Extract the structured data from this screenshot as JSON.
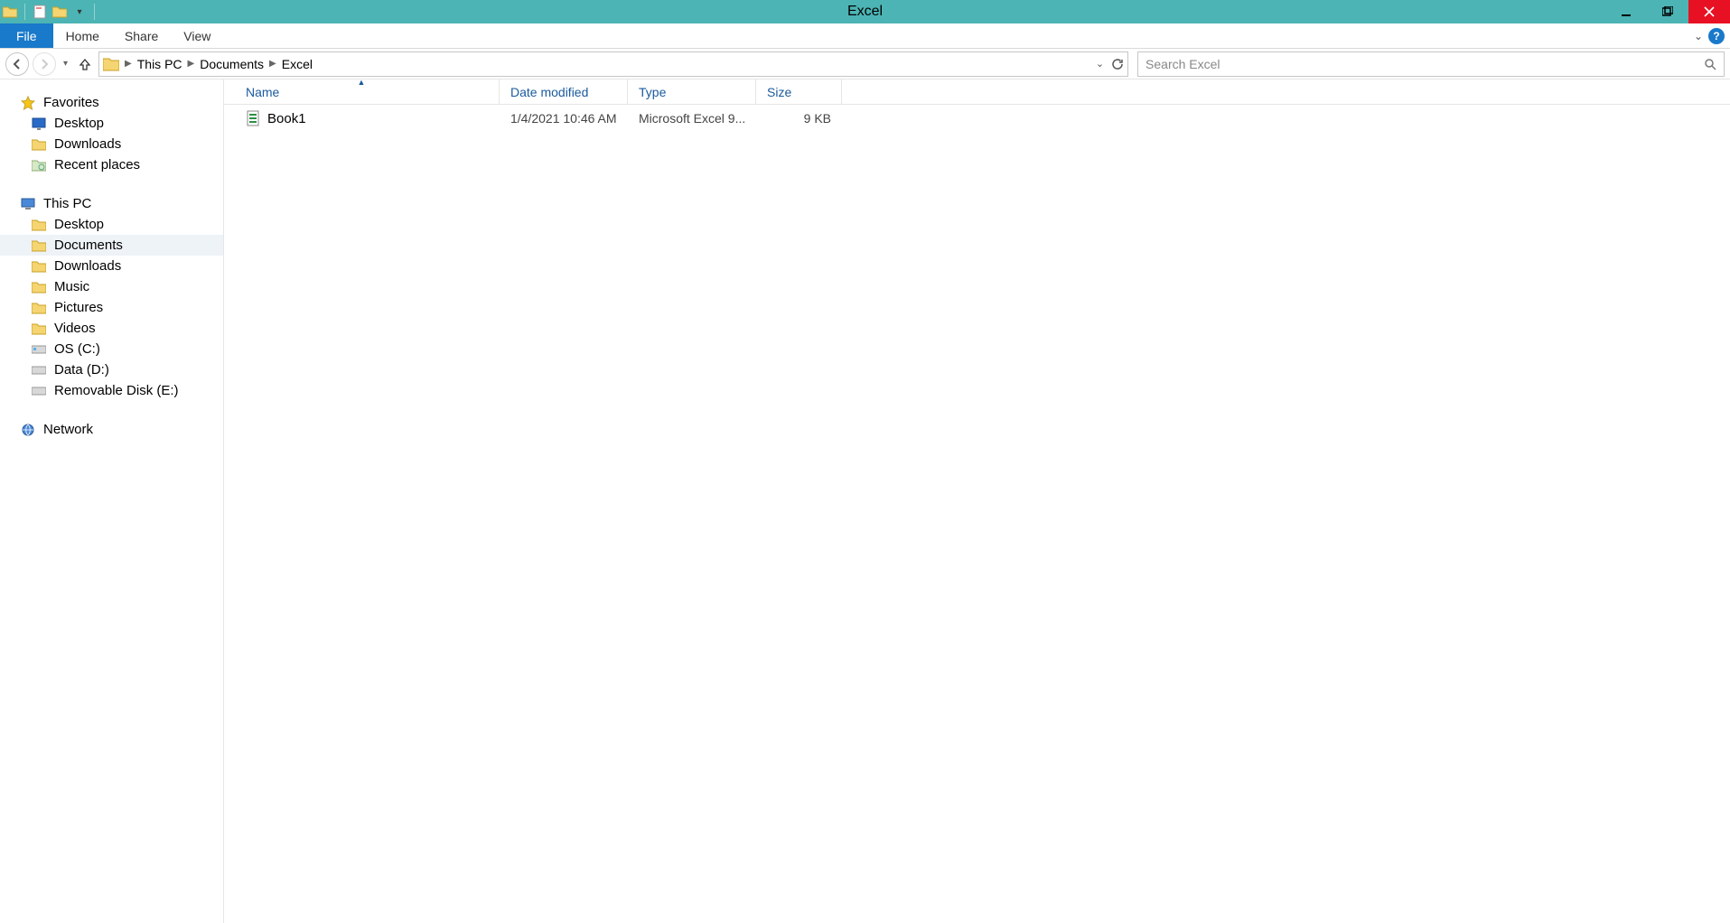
{
  "titlebar": {
    "title": "Excel"
  },
  "ribbon": {
    "file": "File",
    "tabs": [
      "Home",
      "Share",
      "View"
    ]
  },
  "address": {
    "crumbs": [
      "This PC",
      "Documents",
      "Excel"
    ]
  },
  "search": {
    "placeholder": "Search Excel"
  },
  "navpane": {
    "favorites": {
      "label": "Favorites",
      "items": [
        "Desktop",
        "Downloads",
        "Recent places"
      ]
    },
    "thispc": {
      "label": "This PC",
      "items": [
        "Desktop",
        "Documents",
        "Downloads",
        "Music",
        "Pictures",
        "Videos",
        "OS (C:)",
        "Data (D:)",
        "Removable Disk (E:)"
      ],
      "selected_index": 1
    },
    "network": {
      "label": "Network"
    }
  },
  "columns": {
    "name": "Name",
    "date": "Date modified",
    "type": "Type",
    "size": "Size"
  },
  "files": [
    {
      "name": "Book1",
      "date": "1/4/2021 10:46 AM",
      "type": "Microsoft Excel 9...",
      "size": "9 KB"
    }
  ]
}
